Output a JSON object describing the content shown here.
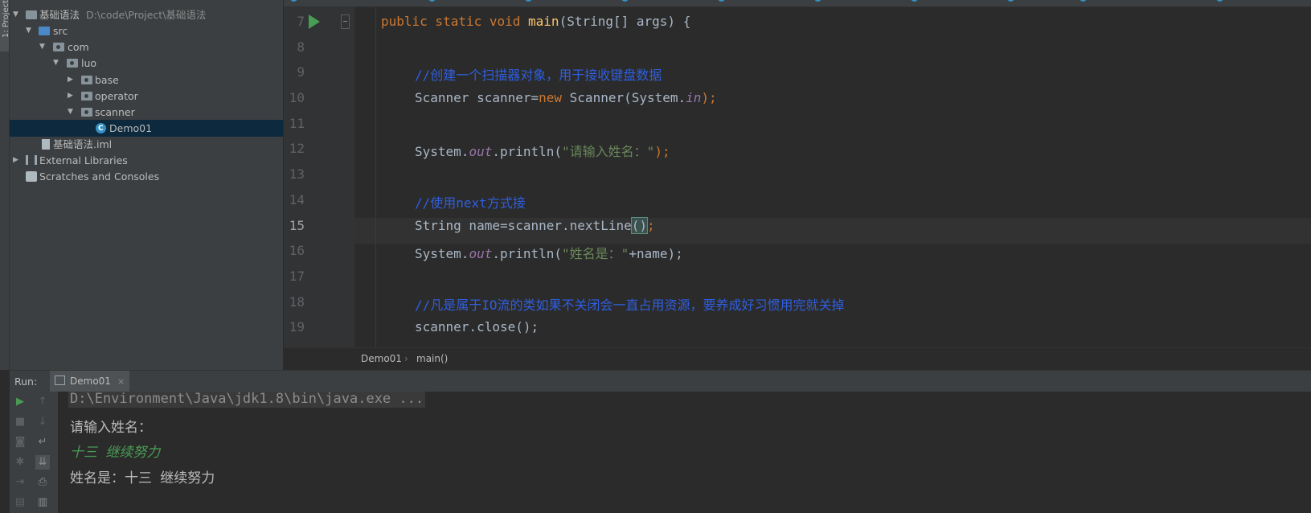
{
  "side_tab": "1: Project",
  "project": {
    "items": [
      {
        "label": "基础语法",
        "path": "D:\\code\\Project\\基础语法"
      },
      {
        "label": "src"
      },
      {
        "label": "com"
      },
      {
        "label": "luo"
      },
      {
        "label": "base"
      },
      {
        "label": "operator"
      },
      {
        "label": "scanner"
      },
      {
        "label": "Demo01"
      },
      {
        "label": "基础语法.iml"
      },
      {
        "label": "External Libraries"
      },
      {
        "label": "Scratches and Consoles"
      }
    ]
  },
  "editor": {
    "line_numbers": [
      "7",
      "8",
      "9",
      "10",
      "11",
      "12",
      "13",
      "14",
      "15",
      "16",
      "17",
      "18",
      "19"
    ],
    "current_line": "15",
    "code": {
      "l7_kw": "public static void ",
      "l7_fn": "main",
      "l7_rest": "(String[] args) {",
      "l9_comment": "//创建一个扫描器对象，用于接收键盘数据",
      "l10_a": "Scanner scanner=",
      "l10_kw": "new",
      "l10_b": " Scanner(System.",
      "l10_fld": "in",
      "l10_c": ");",
      "l12_a": "System.",
      "l12_fld": "out",
      "l12_b": ".println(",
      "l12_str": "\"请输入姓名：\"",
      "l12_c": ");",
      "l14_comment": "//使用next方式接",
      "l15_a": "String name=scanner.nextLine",
      "l15_paren": "()",
      "l15_b": ";",
      "l16_a": "System.",
      "l16_fld": "out",
      "l16_b": ".println(",
      "l16_str": "\"姓名是：\"",
      "l16_c": "+name);",
      "l18_comment": "//凡是属于IO流的类如果不关闭会一直占用资源，要养成好习惯用完就关掉",
      "l19": "scanner.close();"
    }
  },
  "breadcrumb": {
    "class": "Demo01",
    "separator": "›",
    "method": "main()"
  },
  "run": {
    "label": "Run:",
    "tab": "Demo01",
    "close": "×",
    "console": [
      "D:\\Environment\\Java\\jdk1.8\\bin\\java.exe ...",
      "请输入姓名：",
      "十三 继续努力",
      "姓名是：十三 继续努力"
    ]
  }
}
